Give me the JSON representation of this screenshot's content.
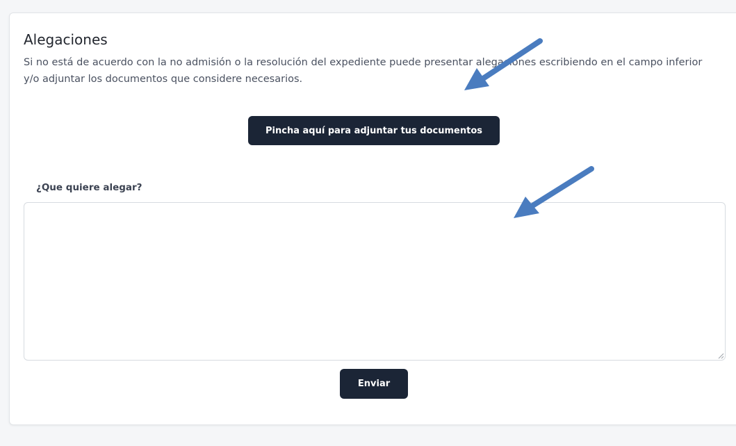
{
  "allegations": {
    "title": "Alegaciones",
    "description": "Si no está de acuerdo con la no admisión o la resolución del expediente puede presentar alegaciones escribiendo en el campo inferior y/o adjuntar los documentos que considere necesarios.",
    "attach_button_label": "Pincha aquí para adjuntar tus documentos",
    "field_label": "¿Que quiere alegar?",
    "field_value": "",
    "field_placeholder": "",
    "submit_button_label": "Enviar"
  },
  "annotations": {
    "arrow_color": "#4a7cbf",
    "arrows": [
      "arrow-to-description",
      "arrow-to-textarea"
    ]
  },
  "theme": {
    "button_bg": "#1b2536",
    "card_bg": "#ffffff",
    "page_bg": "#f5f6f8"
  }
}
